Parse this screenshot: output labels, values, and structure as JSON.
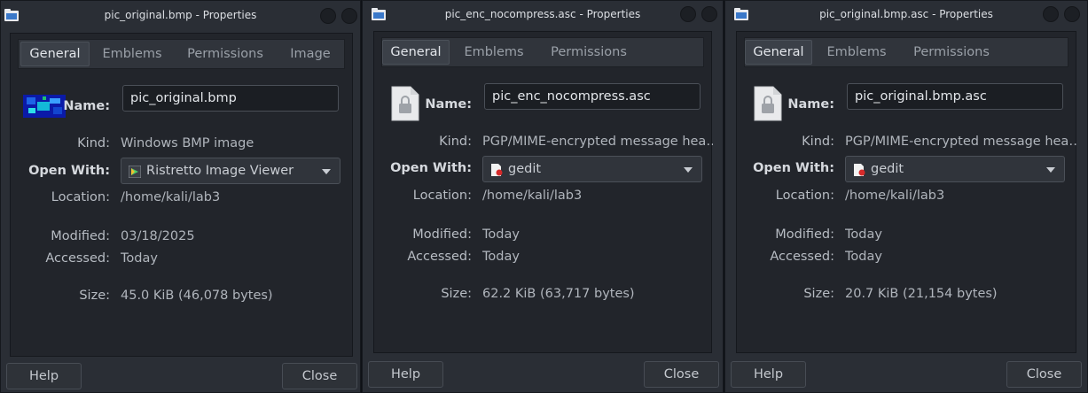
{
  "windows": [
    {
      "title": "pic_original.bmp - Properties",
      "tabs": [
        "General",
        "Emblems",
        "Permissions",
        "Image"
      ],
      "active_tab": "General",
      "icon": "bmp-thumbnail",
      "name_label": "Name:",
      "name_value": "pic_original.bmp",
      "kind_label": "Kind:",
      "kind_value": "Windows BMP image",
      "open_with_label": "Open With:",
      "open_with_value": "Ristretto Image Viewer",
      "location_label": "Location:",
      "location_value": "/home/kali/lab3",
      "modified_label": "Modified:",
      "modified_value": "03/18/2025",
      "accessed_label": "Accessed:",
      "accessed_value": "Today",
      "size_label": "Size:",
      "size_value": "45.0 KiB (46,078 bytes)",
      "help_label": "Help",
      "close_label": "Close"
    },
    {
      "title": "pic_enc_nocompress.asc - Properties",
      "tabs": [
        "General",
        "Emblems",
        "Permissions"
      ],
      "active_tab": "General",
      "icon": "locked-file-icon",
      "name_label": "Name:",
      "name_value": "pic_enc_nocompress.asc",
      "kind_label": "Kind:",
      "kind_value": "PGP/MIME-encrypted message hea…",
      "open_with_label": "Open With:",
      "open_with_value": "gedit",
      "location_label": "Location:",
      "location_value": "/home/kali/lab3",
      "modified_label": "Modified:",
      "modified_value": "Today",
      "accessed_label": "Accessed:",
      "accessed_value": "Today",
      "size_label": "Size:",
      "size_value": "62.2 KiB (63,717 bytes)",
      "help_label": "Help",
      "close_label": "Close"
    },
    {
      "title": "pic_original.bmp.asc - Properties",
      "tabs": [
        "General",
        "Emblems",
        "Permissions"
      ],
      "active_tab": "General",
      "icon": "locked-file-icon",
      "name_label": "Name:",
      "name_value": "pic_original.bmp.asc",
      "kind_label": "Kind:",
      "kind_value": "PGP/MIME-encrypted message hea…",
      "open_with_label": "Open With:",
      "open_with_value": "gedit",
      "location_label": "Location:",
      "location_value": "/home/kali/lab3",
      "modified_label": "Modified:",
      "modified_value": "Today",
      "accessed_label": "Accessed:",
      "accessed_value": "Today",
      "size_label": "Size:",
      "size_value": "20.7 KiB (21,154 bytes)",
      "help_label": "Help",
      "close_label": "Close"
    }
  ],
  "colors": {
    "window_bg": "#2a2e35",
    "panel_bg": "#22252b",
    "text": "#d8dbe0",
    "muted": "#b0b5bc"
  }
}
